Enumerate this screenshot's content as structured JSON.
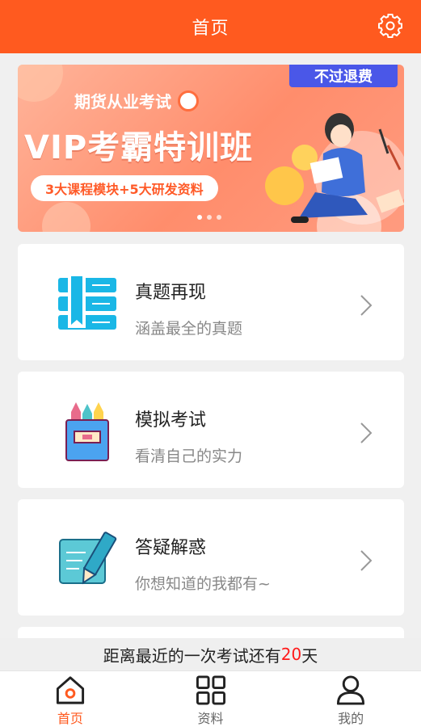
{
  "header": {
    "title": "首页"
  },
  "banner": {
    "badge": "不过退费",
    "subtitle": "期货从业考试",
    "headline": "VIP考霸特训班",
    "pill": "3大课程模块+5大研发资料"
  },
  "cards": [
    {
      "title": "真题再现",
      "desc": "涵盖最全的真题"
    },
    {
      "title": "模拟考试",
      "desc": "看清自己的实力"
    },
    {
      "title": "答疑解惑",
      "desc": "你想知道的我都有~"
    }
  ],
  "countdown": {
    "prefix": "距离最近的一次考试还有",
    "days": "20",
    "suffix": "天"
  },
  "tabs": [
    {
      "label": "首页",
      "icon": "home-icon",
      "active": true
    },
    {
      "label": "资料",
      "icon": "grid-icon",
      "active": false
    },
    {
      "label": "我的",
      "icon": "user-icon",
      "active": false
    }
  ],
  "colors": {
    "accent": "#ff5a1f",
    "countdown_number": "#ff1a1a"
  }
}
